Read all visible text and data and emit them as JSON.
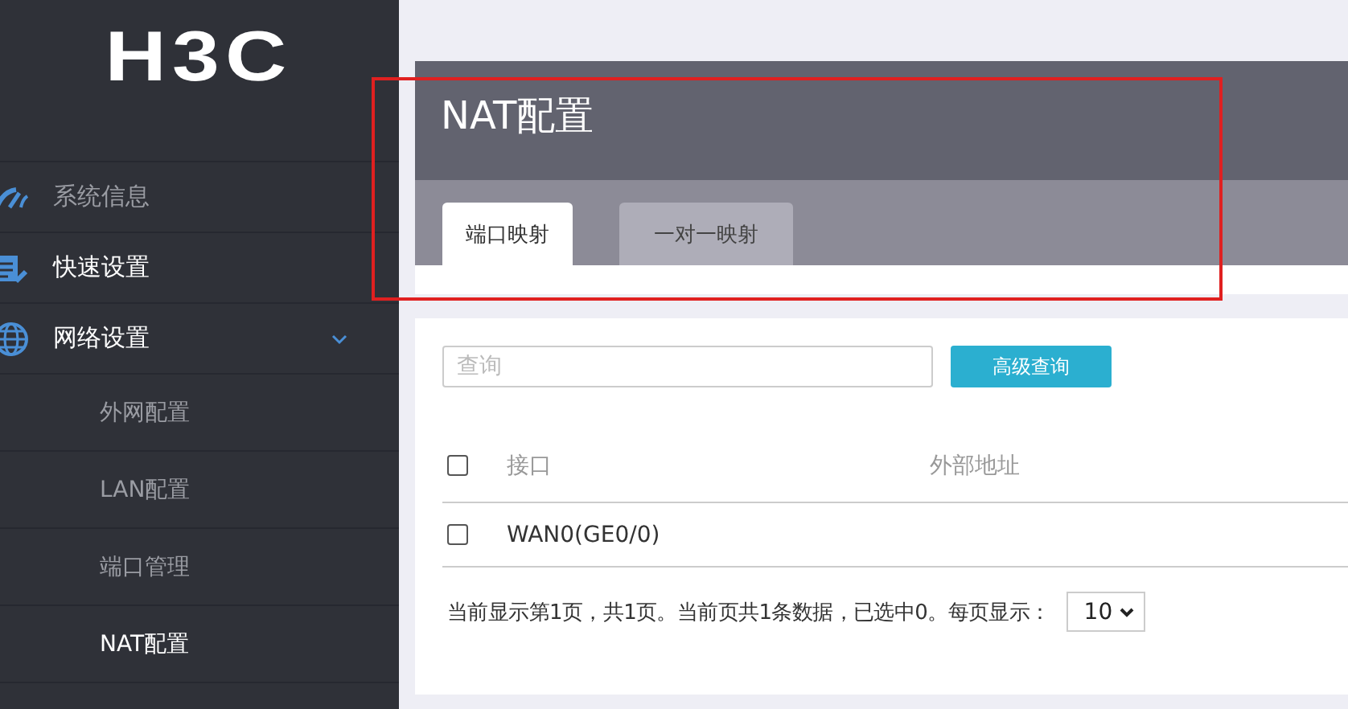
{
  "logo": {
    "text": "H3C"
  },
  "sidebar": {
    "items": [
      {
        "label": "系统信息",
        "highlighted": false
      },
      {
        "label": "快速设置",
        "highlighted": true
      },
      {
        "label": "网络设置",
        "highlighted": true,
        "expanded": true,
        "children": [
          {
            "label": "外网配置",
            "selected": false
          },
          {
            "label": "LAN配置",
            "selected": false
          },
          {
            "label": "端口管理",
            "selected": false
          },
          {
            "label": "NAT配置",
            "selected": true
          }
        ]
      }
    ]
  },
  "page": {
    "title": "NAT配置"
  },
  "tabs": [
    {
      "label": "端口映射",
      "selected": true
    },
    {
      "label": "一对一映射",
      "selected": false
    }
  ],
  "search": {
    "placeholder": "查询"
  },
  "advanced_search_button": "高级查询",
  "table": {
    "columns": [
      "接口",
      "外部地址"
    ],
    "header_checked": false,
    "rows": [
      {
        "checked": false,
        "cells": [
          "WAN0(GE0/0)",
          ""
        ]
      }
    ]
  },
  "footer": {
    "summary": "当前显示第1页，共1页。当前页共1条数据，已选中0。每页显示：",
    "page_size": "10"
  },
  "highlight_box": {
    "shown": true
  }
}
